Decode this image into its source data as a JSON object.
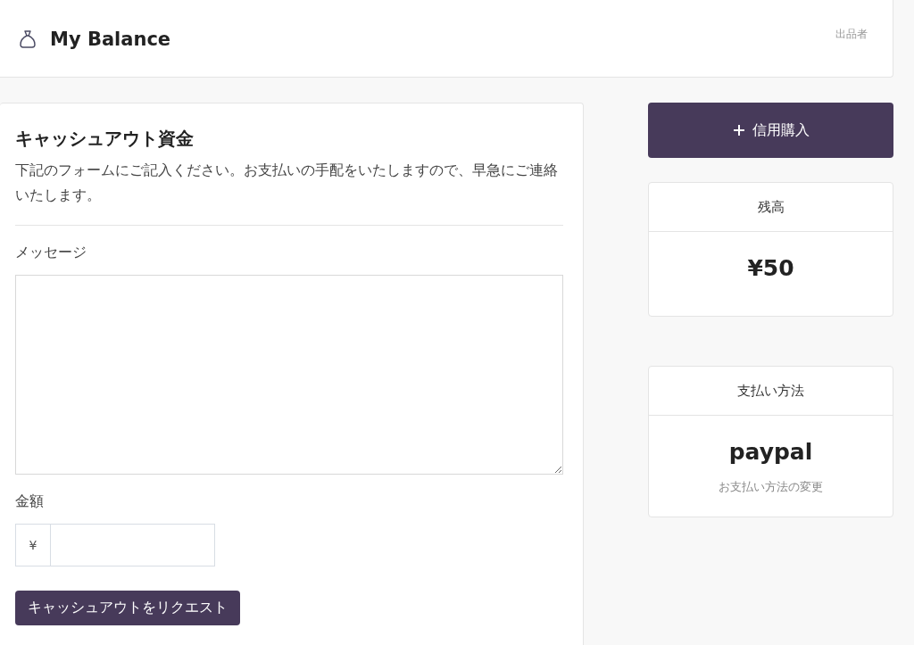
{
  "header": {
    "title": "My Balance",
    "role": "出品者"
  },
  "cashout": {
    "title": "キャッシュアウト資金",
    "description": "下記のフォームにご記入ください。お支払いの手配をいたしますので、早急にご連絡いたします。",
    "message_label": "メッセージ",
    "amount_label": "金額",
    "currency": "¥",
    "submit": "キャッシュアウトをリクエスト"
  },
  "buy_credit_button": "信用購入",
  "balance": {
    "title": "残高",
    "value": "¥50"
  },
  "payment": {
    "title": "支払い方法",
    "method": "paypal",
    "change_link": "お支払い方法の変更"
  }
}
